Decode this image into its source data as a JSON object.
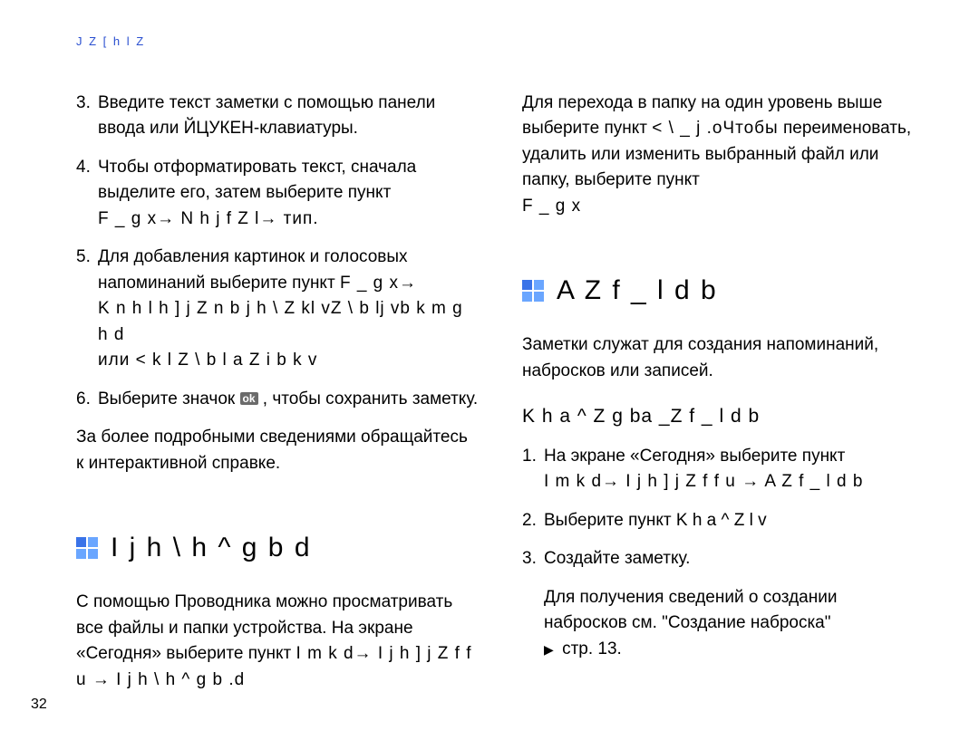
{
  "breadcrumb": "J Z [ h l Z",
  "left": {
    "list1": [
      {
        "n": "3.",
        "text": "Введите текст заметки с помощью панели ввода или ЙЦУКЕН-клавиатуры."
      },
      {
        "n": "4.",
        "text_plain": "Чтобы отформатировать текст, сначала выделите его, затем выберите пункт",
        "tail": "F _ g x→  N h j f Z l→  тип."
      },
      {
        "n": "5.",
        "text_plain": "Для добавления картинок и голосовых напоминаний выберите пункт ",
        "tail": "F _ g x→",
        "tail2": "K n h l h ] j Z n b j h \\ Z kl vZ \\ b lj vb k m g h d",
        "tail3": "или  < k l Z \\ b l a Z i b k v"
      },
      {
        "n": "6.",
        "pre": "Выберите значок ",
        "ok": "ok",
        "post": ", чтобы сохранить заметку."
      }
    ],
    "after_list": "За более подробными сведениями обращайтесь к интерактивной справке.",
    "heading": "I j h \\ h ^ g b d",
    "body": "С помощью Проводника можно просматривать все файлы и папки устройства. На экране «Сегодня» выберите пункт ",
    "body_tail": "I m k d→  I j h ] j Z f f u  →  I j h \\ h ^ g b .d"
  },
  "right": {
    "top1": "Для перехода в папку на один уровень выше выберите пункт ",
    "top1_tail": "< \\ _ j .oЧтобы",
    "top2": "переименовать, удалить или изменить выбранный файл или папку, выберите пункт",
    "top2_tail": "F _ g x",
    "heading": "A Z f _ l d b",
    "intro": "Заметки служат для создания напоминаний, набросков или записей.",
    "subhead": "K h a ^ Z g ba _Z f _ l d b",
    "list": [
      {
        "n": "1.",
        "text": "На экране «Сегодня» выберите пункт",
        "tail": "I m k d→  I j h ] j Z f f u  →  A Z f _ l d b"
      },
      {
        "n": "2.",
        "text": "Выберите пункт  K h a ^ Z l v"
      },
      {
        "n": "3.",
        "text": "Создайте заметку."
      }
    ],
    "closing": "Для получения сведений о создании набросков см. \"Создание наброска\"",
    "closing_tail": "стр. 13."
  },
  "pagenum": "32"
}
